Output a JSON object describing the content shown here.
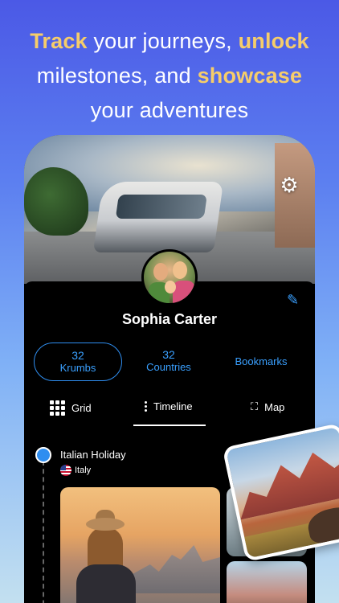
{
  "headline": {
    "part1": "Track",
    "part2": " your journeys, ",
    "part3": "unlock",
    "part4": "milestones, and ",
    "part5": "showcase",
    "part6": "your adventures"
  },
  "profile": {
    "name": "Sophia Carter"
  },
  "stats": {
    "krumbs_count": "32",
    "krumbs_label": "Krumbs",
    "countries_count": "32",
    "countries_label": "Countries",
    "bookmarks_label": "Bookmarks"
  },
  "tabs": {
    "grid_label": "Grid",
    "timeline_label": "Timeline",
    "map_label": "Map",
    "active": "Timeline"
  },
  "timeline": {
    "entry_title": "Italian Holiday",
    "entry_country": "Italy"
  },
  "icons": {
    "settings": "gear-icon",
    "edit": "pencil-icon",
    "grid": "grid-icon",
    "timeline": "dots-vertical-icon",
    "map": "map-icon",
    "flag": "us-flag-icon"
  },
  "colors": {
    "accent": "#3aa0ff",
    "highlight": "#f6cd6a"
  }
}
